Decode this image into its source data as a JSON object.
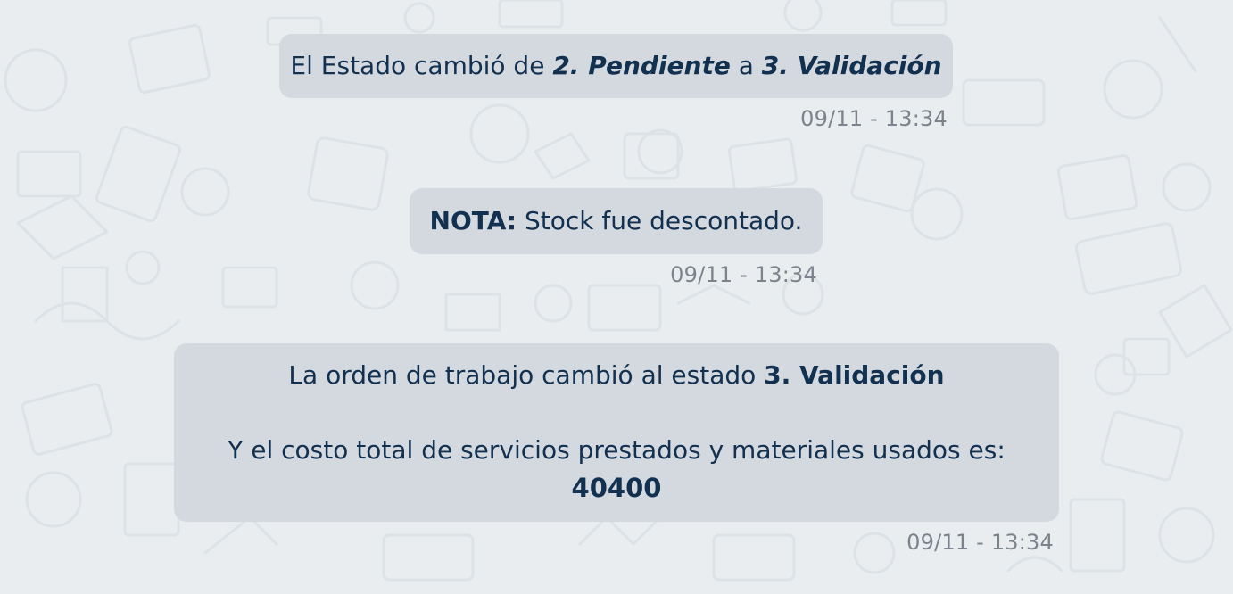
{
  "colors": {
    "background": "#e9edf0",
    "bubble": "#d3d9df",
    "text": "#12304f",
    "timestamp": "#7c838c"
  },
  "messages": [
    {
      "pre": "El Estado cambió de ",
      "from_state": "2. Pendiente",
      "mid": " a ",
      "to_state": "3. Validación",
      "timestamp": "09/11 - 13:34"
    },
    {
      "label": "NOTA:",
      "text": " Stock fue descontado.",
      "timestamp": "09/11 - 13:34"
    },
    {
      "line1_text": "La orden de trabajo cambió al estado ",
      "line1_state": "3. Validación",
      "line2_text": "Y el costo total de servicios prestados y materiales usados es:",
      "total": "40400",
      "timestamp": "09/11 - 13:34"
    }
  ]
}
